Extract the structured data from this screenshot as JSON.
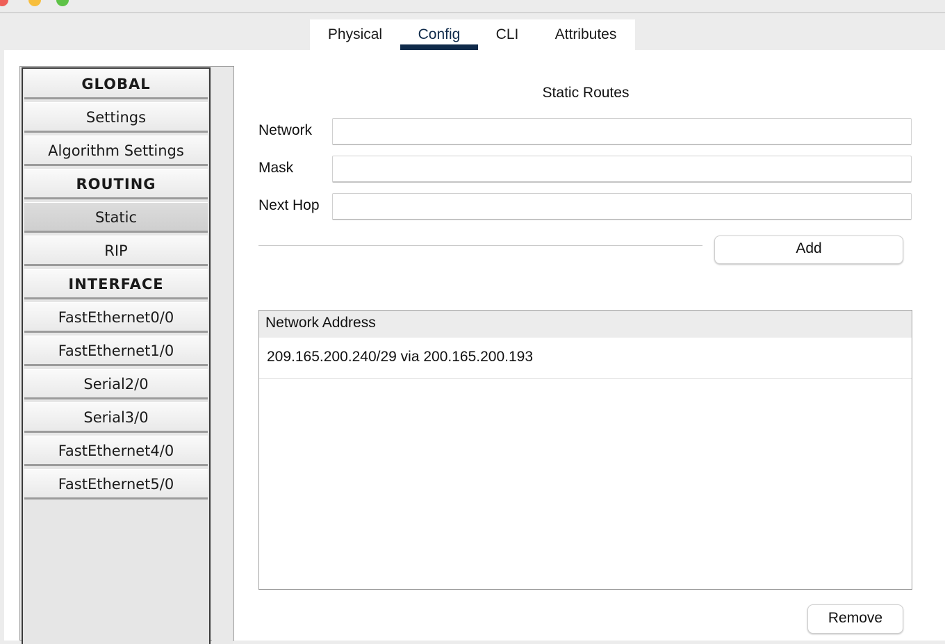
{
  "tabs": [
    "Physical",
    "Config",
    "CLI",
    "Attributes"
  ],
  "active_tab": "Config",
  "sidebar": {
    "items": [
      {
        "label": "GLOBAL",
        "type": "header"
      },
      {
        "label": "Settings",
        "type": "item"
      },
      {
        "label": "Algorithm Settings",
        "type": "item"
      },
      {
        "label": "ROUTING",
        "type": "header"
      },
      {
        "label": "Static",
        "type": "item",
        "selected": true
      },
      {
        "label": "RIP",
        "type": "item"
      },
      {
        "label": "INTERFACE",
        "type": "header"
      },
      {
        "label": "FastEthernet0/0",
        "type": "item"
      },
      {
        "label": "FastEthernet1/0",
        "type": "item"
      },
      {
        "label": "Serial2/0",
        "type": "item"
      },
      {
        "label": "Serial3/0",
        "type": "item"
      },
      {
        "label": "FastEthernet4/0",
        "type": "item"
      },
      {
        "label": "FastEthernet5/0",
        "type": "item"
      }
    ]
  },
  "static_routes": {
    "title": "Static Routes",
    "fields": {
      "network": {
        "label": "Network",
        "value": ""
      },
      "mask": {
        "label": "Mask",
        "value": ""
      },
      "next_hop": {
        "label": "Next Hop",
        "value": ""
      }
    },
    "add_label": "Add",
    "list_header": "Network Address",
    "routes": [
      "209.165.200.240/29 via 200.165.200.193"
    ],
    "remove_label": "Remove"
  },
  "colors": {
    "tab_accent": "#0f2a4a",
    "window_bg": "#ececec"
  }
}
